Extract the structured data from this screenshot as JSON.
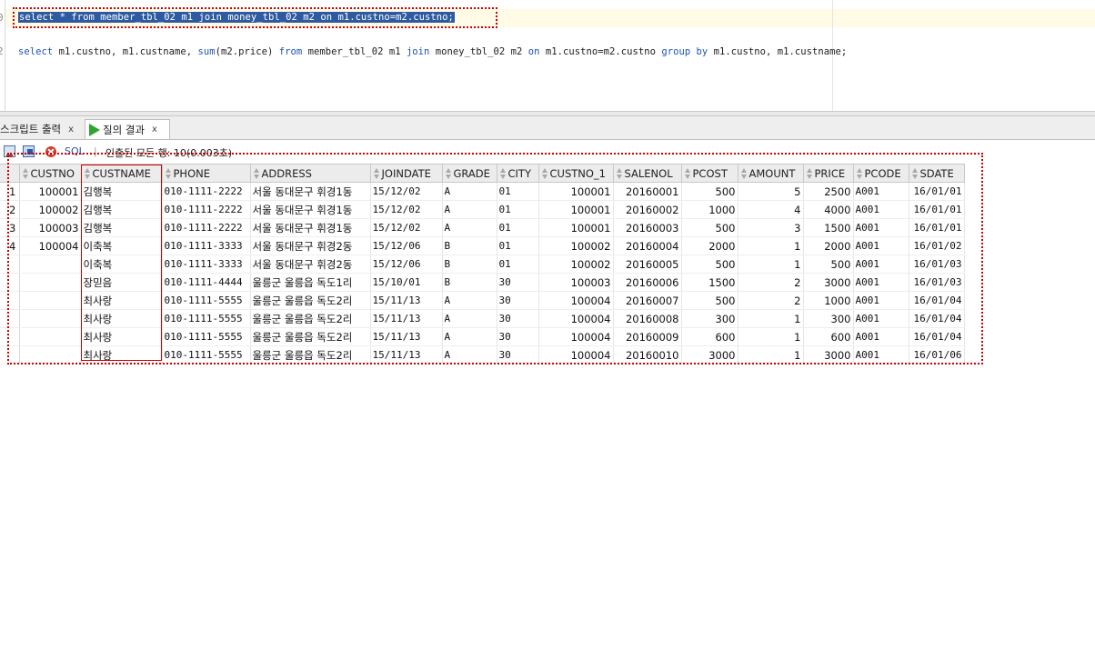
{
  "editor": {
    "line_numbers": [
      "0",
      "2"
    ],
    "line1": {
      "parts": [
        "select ",
        "* ",
        "from member_tbl_02 m1 join money_tbl_02 m2 on m1.custno=m2.custno;"
      ]
    },
    "line2": {
      "kw_select": "select",
      "text1": " m1.custno, m1.custname, ",
      "kw_sum": "sum",
      "text2": "(m2.price) ",
      "kw_from": "from",
      "text3": " member_tbl_02 m1 ",
      "kw_join": "join",
      "text4": " money_tbl_02 m2 ",
      "kw_on": "on",
      "text5": " m1.custno=m2.custno ",
      "kw_groupby": "group by",
      "text6": " m1.custno, m1.custname;"
    }
  },
  "tabs": [
    {
      "label": "스크립트 출력",
      "close": "x"
    },
    {
      "label": "질의 결과",
      "close": "x"
    }
  ],
  "toolbar": {
    "sql_label": "SQL",
    "separator": "|",
    "status": "인출된 모든 행: 10(0.003초)"
  },
  "grid": {
    "columns": [
      "CUSTNO",
      "CUSTNAME",
      "PHONE",
      "ADDRESS",
      "JOINDATE",
      "GRADE",
      "CITY",
      "CUSTNO_1",
      "SALENOL",
      "PCOST",
      "AMOUNT",
      "PRICE",
      "PCODE",
      "SDATE"
    ],
    "rows": [
      [
        "1",
        "100001",
        "김행복",
        "010-1111-2222",
        "서울 동대문구 휘경1동",
        "15/12/02",
        "A",
        "01",
        "100001",
        "20160001",
        "500",
        "5",
        "2500",
        "A001",
        "16/01/01"
      ],
      [
        "2",
        "100002",
        "김행복",
        "010-1111-2222",
        "서울 동대문구 휘경1동",
        "15/12/02",
        "A",
        "01",
        "100001",
        "20160002",
        "1000",
        "4",
        "4000",
        "A001",
        "16/01/01"
      ],
      [
        "3",
        "100003",
        "김행복",
        "010-1111-2222",
        "서울 동대문구 휘경1동",
        "15/12/02",
        "A",
        "01",
        "100001",
        "20160003",
        "500",
        "3",
        "1500",
        "A001",
        "16/01/01"
      ],
      [
        "4",
        "100004",
        "이축복",
        "010-1111-3333",
        "서울 동대문구 휘경2동",
        "15/12/06",
        "B",
        "01",
        "100002",
        "20160004",
        "2000",
        "1",
        "2000",
        "A001",
        "16/01/02"
      ],
      [
        "",
        "",
        "이축복",
        "010-1111-3333",
        "서울 동대문구 휘경2동",
        "15/12/06",
        "B",
        "01",
        "100002",
        "20160005",
        "500",
        "1",
        "500",
        "A001",
        "16/01/03"
      ],
      [
        "",
        "",
        "장믿음",
        "010-1111-4444",
        "울릉군 울릉읍 독도1리",
        "15/10/01",
        "B",
        "30",
        "100003",
        "20160006",
        "1500",
        "2",
        "3000",
        "A001",
        "16/01/03"
      ],
      [
        "",
        "",
        "최사랑",
        "010-1111-5555",
        "울릉군 울릉읍 독도2리",
        "15/11/13",
        "A",
        "30",
        "100004",
        "20160007",
        "500",
        "2",
        "1000",
        "A001",
        "16/01/04"
      ],
      [
        "",
        "",
        "최사랑",
        "010-1111-5555",
        "울릉군 울릉읍 독도2리",
        "15/11/13",
        "A",
        "30",
        "100004",
        "20160008",
        "300",
        "1",
        "300",
        "A001",
        "16/01/04"
      ],
      [
        "",
        "",
        "최사랑",
        "010-1111-5555",
        "울릉군 울릉읍 독도2리",
        "15/11/13",
        "A",
        "30",
        "100004",
        "20160009",
        "600",
        "1",
        "600",
        "A001",
        "16/01/04"
      ],
      [
        "",
        "",
        "최사랑",
        "010-1111-5555",
        "울릉군 울릉읍 독도2리",
        "15/11/13",
        "A",
        "30",
        "100004",
        "20160010",
        "3000",
        "1",
        "3000",
        "A001",
        "16/01/06"
      ]
    ]
  },
  "colors": {
    "selection": "#2d5aa0",
    "keyword": "#1a55b0",
    "annotation": "#cc0000",
    "run_icon": "#2fa52f"
  }
}
